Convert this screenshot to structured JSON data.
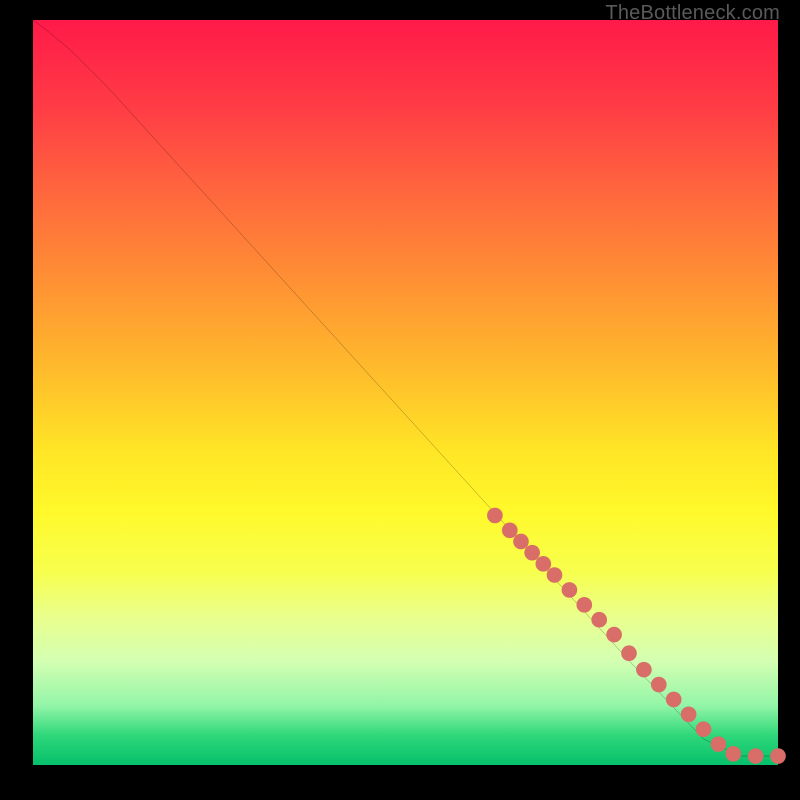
{
  "watermark": "TheBottleneck.com",
  "colors": {
    "background_black": "#000000",
    "curve": "#000000",
    "marker_fill": "#d86e67",
    "gradient_top": "#ff1a49",
    "gradient_bottom": "#05c06b"
  },
  "chart_data": {
    "type": "line",
    "title": "",
    "xlabel": "",
    "ylabel": "",
    "xlim": [
      0,
      100
    ],
    "ylim": [
      0,
      100
    ],
    "grid": false,
    "legend": false,
    "curve": {
      "comment": "approximate bottleneck curve from top-left to bottom-right",
      "x": [
        0,
        2,
        5,
        10,
        20,
        30,
        40,
        50,
        60,
        70,
        80,
        90,
        95,
        100
      ],
      "y": [
        100,
        98.5,
        96,
        91,
        80,
        69,
        58,
        47,
        36,
        25,
        14,
        3.5,
        1.2,
        1.2
      ]
    },
    "markers": {
      "comment": "salmon dots along lower-right portion of curve; values estimated from gridless plot",
      "x": [
        62,
        64,
        65.5,
        67,
        68.5,
        70,
        72,
        74,
        76,
        78,
        80,
        82,
        84,
        86,
        88,
        90,
        92,
        94,
        97,
        100
      ],
      "y": [
        33.5,
        31.5,
        30,
        28.5,
        27,
        25.5,
        23.5,
        21.5,
        19.5,
        17.5,
        15,
        12.8,
        10.8,
        8.8,
        6.8,
        4.8,
        2.8,
        1.5,
        1.2,
        1.2
      ]
    }
  }
}
